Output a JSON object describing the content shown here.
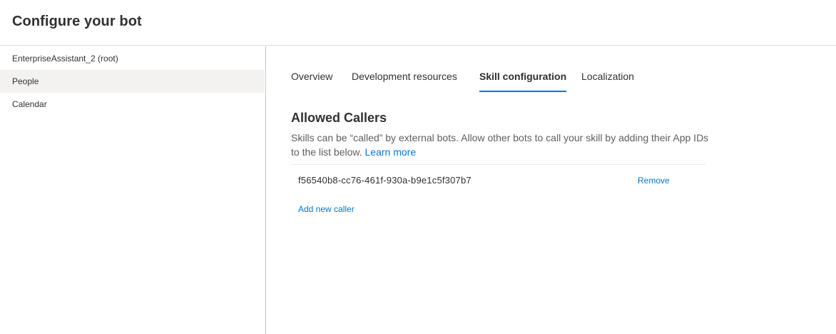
{
  "header": {
    "title": "Configure your bot"
  },
  "sidebar": {
    "items": [
      {
        "label": "EnterpriseAssistant_2 (root)",
        "selected": false
      },
      {
        "label": "People",
        "selected": true
      },
      {
        "label": "Calendar",
        "selected": false
      }
    ]
  },
  "tabs": [
    {
      "label": "Overview",
      "active": false
    },
    {
      "label": "Development resources",
      "active": false
    },
    {
      "label": "Skill configuration",
      "active": true
    },
    {
      "label": "Localization",
      "active": false
    }
  ],
  "allowed_callers": {
    "title": "Allowed Callers",
    "description": "Skills can be “called” by external bots. Allow other bots to call your skill by adding their App IDs to the list below.",
    "learn_more": "Learn more",
    "callers": [
      {
        "id": "f56540b8-cc76-461f-930a-b9e1c5f307b7",
        "remove_label": "Remove"
      }
    ],
    "add_label": "Add new caller"
  },
  "colors": {
    "accent": "#0078d4",
    "selected_bg": "#f3f2f1",
    "text": "#323130",
    "secondary_text": "#605e5c"
  }
}
